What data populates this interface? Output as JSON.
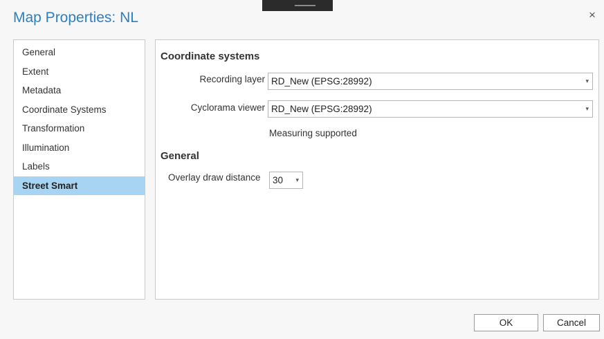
{
  "window": {
    "title": "Map Properties: NL",
    "close_glyph": "×",
    "close_icon": "close-icon"
  },
  "nav": {
    "items": [
      {
        "label": "General",
        "selected": false
      },
      {
        "label": "Extent",
        "selected": false
      },
      {
        "label": "Metadata",
        "selected": false
      },
      {
        "label": "Coordinate Systems",
        "selected": false
      },
      {
        "label": "Transformation",
        "selected": false
      },
      {
        "label": "Illumination",
        "selected": false
      },
      {
        "label": "Labels",
        "selected": false
      },
      {
        "label": "Street Smart",
        "selected": true
      }
    ],
    "selected_color": "#a6d4f2"
  },
  "coordinate_systems": {
    "heading": "Coordinate systems",
    "recording_layer": {
      "label": "Recording layer",
      "value": "RD_New (EPSG:28992)"
    },
    "cyclorama_viewer": {
      "label": "Cyclorama viewer",
      "value": "RD_New (EPSG:28992)"
    },
    "status": "Measuring supported"
  },
  "general": {
    "heading": "General",
    "overlay_draw_distance": {
      "label": "Overlay draw distance",
      "value": "30"
    }
  },
  "buttons": {
    "ok": "OK",
    "cancel": "Cancel"
  },
  "colors": {
    "title": "#2e7fc0"
  },
  "dropdown_glyph": "▾"
}
